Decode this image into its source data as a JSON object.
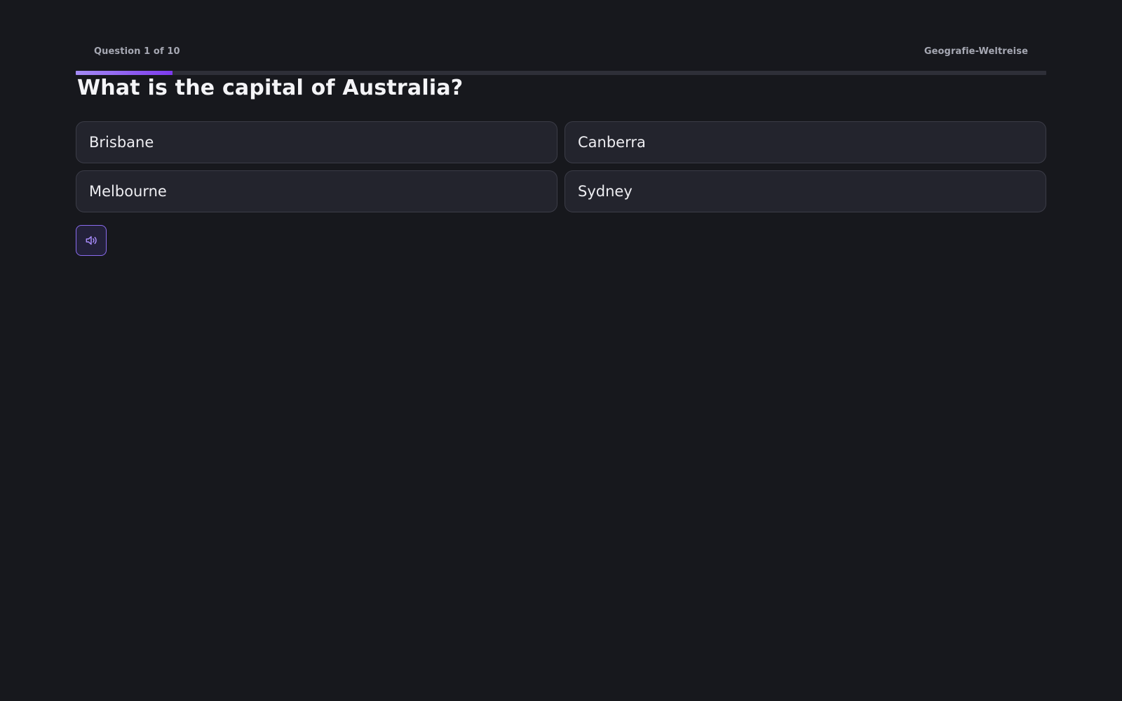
{
  "header": {
    "question_counter": "Question 1 of 10",
    "quiz_name": "Geografie-Weltreise"
  },
  "progress": {
    "current": 1,
    "total": 10,
    "fraction": 0.1
  },
  "question": {
    "text": "What is the capital of Australia?"
  },
  "answers": [
    {
      "label": "Brisbane"
    },
    {
      "label": "Canberra"
    },
    {
      "label": "Melbourne"
    },
    {
      "label": "Sydney"
    }
  ],
  "controls": {
    "sound_icon": "speaker-icon"
  },
  "colors": {
    "accent": "#8b5cf6",
    "accent_dark": "#7c3aed",
    "background": "#17181d",
    "card": "#23242d"
  }
}
